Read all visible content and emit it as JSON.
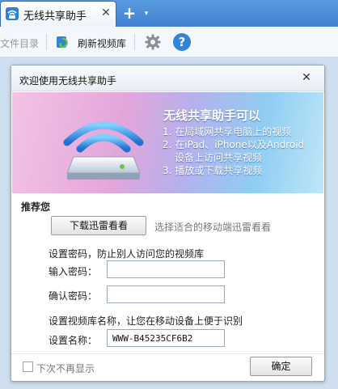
{
  "browser": {
    "tab_title": "无线共享助手",
    "tab_close": "✕",
    "new_tab": "+",
    "new_tab_menu": "▾"
  },
  "toolbar": {
    "folder_label": "文件目录",
    "refresh_label": "刷新视频库",
    "settings_icon": "gear-icon",
    "help_label": "?"
  },
  "dialog": {
    "title": "欢迎使用无线共享助手",
    "close_label": "✕",
    "banner": {
      "heading": "无线共享助手可以",
      "lines": [
        "1. 在局域网共享电脑上的视频",
        "2. 在iPad、iPhone以及Android",
        "设备上访问共享视频",
        "3. 播放或下载共享视频"
      ]
    },
    "recommend_label": "推荐您",
    "download_button": "下载迅雷看看",
    "download_hint": "选择适合的移动端迅雷看看",
    "password_desc": "设置密码，防止别人访问您的视频库",
    "password_label": "输入密码：",
    "password_value": "",
    "confirm_label": "确认密码：",
    "confirm_value": "",
    "name_desc": "设置视频库名称，让您在移动设备上便于识别",
    "name_label": "设置名称：",
    "name_value": "WWW-B45235CF6B2",
    "dont_show_label": "下次不再显示",
    "dont_show_checked": false,
    "ok_button": "确定"
  },
  "colors": {
    "tabstrip": "#4a8ad8",
    "accent": "#2f86d8",
    "banner_pink": "#e3a6da",
    "banner_blue": "#8fcdf2"
  }
}
